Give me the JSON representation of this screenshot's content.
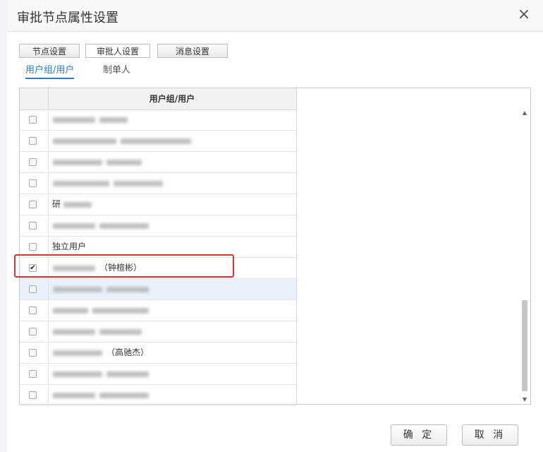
{
  "dialog": {
    "title": "审批节点属性设置",
    "close_glyph": "×"
  },
  "tabs": [
    {
      "label": "节点设置"
    },
    {
      "label": "审批人设置"
    },
    {
      "label": "消息设置"
    }
  ],
  "subtabs": [
    {
      "label": "用户组/用户"
    },
    {
      "label": "制单人"
    }
  ],
  "grid": {
    "header": "用户组/用户",
    "rows": [
      {
        "text": "",
        "checked": false
      },
      {
        "text": "",
        "checked": false
      },
      {
        "text": "",
        "checked": false
      },
      {
        "text": "",
        "checked": false
      },
      {
        "text": "研",
        "checked": false
      },
      {
        "text": "",
        "checked": false
      },
      {
        "text": "独立用户",
        "checked": false
      },
      {
        "text": "（钟楦彬）",
        "checked": true
      },
      {
        "text": "",
        "checked": false
      },
      {
        "text": "",
        "checked": false
      },
      {
        "text": "",
        "checked": false
      },
      {
        "text": "（高驰杰）",
        "checked": false
      },
      {
        "text": "",
        "checked": false
      },
      {
        "text": "",
        "checked": false
      }
    ]
  },
  "buttons": {
    "ok": "确 定",
    "cancel": "取 消"
  },
  "colors": {
    "accent": "#2a7dc6",
    "highlight_border": "#e03030",
    "selected_row": "#e9f2fc"
  }
}
